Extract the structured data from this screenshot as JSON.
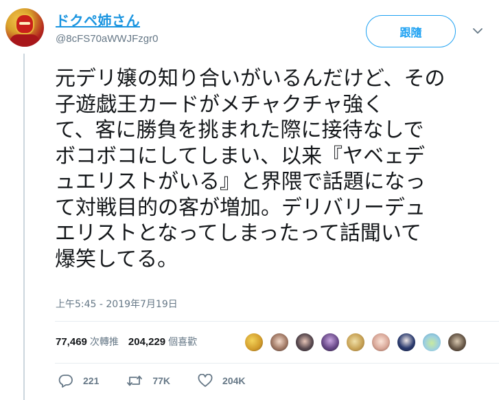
{
  "author": {
    "display_name": "ドクペ姉さん",
    "handle": "@8cFS70aWWJFzgr0",
    "avatar_icon": "superhero-avatar-icon"
  },
  "follow_button": {
    "label": "跟隨"
  },
  "caret_icon": "chevron-down-icon",
  "tweet": {
    "lines": [
      "元デリ嬢の知り合いがいるんだけど、その",
      "子遊戯王カードがメチャクチャ強く",
      "て、客に勝負を挑まれた際に接待なしで",
      "ボコボコにしてしまい、以来『ヤベェデ",
      "ュエリストがいる』と界隈で話題になっ",
      "て対戦目的の客が増加。デリバリーデュ",
      "エリストとなってしまったって話聞いて",
      "爆笑してる。"
    ],
    "timestamp": "上午5:45 - 2019年7月19日"
  },
  "stats": {
    "retweets_count": "77,469",
    "retweets_label": "次轉推",
    "likes_count": "204,229",
    "likes_label": "個喜歡"
  },
  "likers": [
    {
      "icon": "liker-avatar-1",
      "color": "#e0b43a"
    },
    {
      "icon": "liker-avatar-2",
      "color": "#8a6a5c"
    },
    {
      "icon": "liker-avatar-3",
      "color": "#3b3640"
    },
    {
      "icon": "liker-avatar-4",
      "color": "#5a4470"
    },
    {
      "icon": "liker-avatar-5",
      "color": "#c8a356"
    },
    {
      "icon": "liker-avatar-6",
      "color": "#d9a899"
    },
    {
      "icon": "liker-avatar-7",
      "color": "#2b3b6e"
    },
    {
      "icon": "liker-avatar-8",
      "color": "#9ccfe0"
    },
    {
      "icon": "liker-avatar-9",
      "color": "#6a5a4a"
    }
  ],
  "actions": {
    "reply_count": "221",
    "retweet_count": "77K",
    "like_count": "204K"
  },
  "colors": {
    "accent": "#1da1f2",
    "name_link": "#1b95e0",
    "muted": "#657786",
    "text": "#14171a",
    "divider": "#e6ecf0"
  }
}
